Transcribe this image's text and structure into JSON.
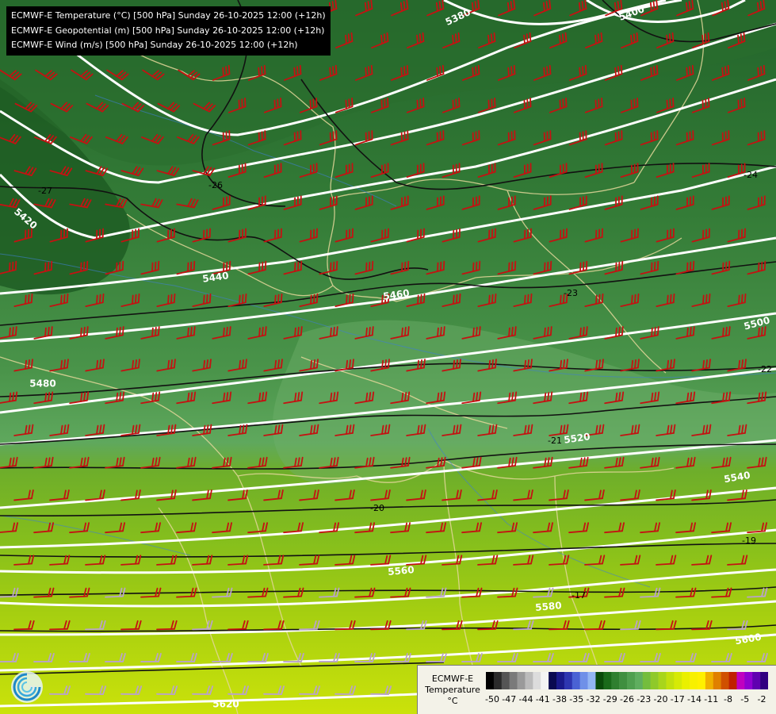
{
  "title_lines": [
    "ECMWF-E Temperature (°C) [500 hPa] Sunday 26-10-2025 12:00 (+12h)",
    "ECMWF-E Geopotential (m) [500 hPa] Sunday 26-10-2025 12:00 (+12h)",
    "ECMWF-E Wind (m/s) [500 hPa] Sunday 26-10-2025 12:00 (+12h)"
  ],
  "legend": {
    "title": [
      "ECMWF-E",
      "Temperature",
      "°C"
    ],
    "tick_labels": [
      "-50",
      "-47",
      "-44",
      "-41",
      "-38",
      "-35",
      "-32",
      "-29",
      "-26",
      "-23",
      "-20",
      "-17",
      "-14",
      "-11",
      "-8",
      "-5",
      "-2"
    ],
    "colors": [
      "#000000",
      "#2a2a2a",
      "#555555",
      "#7a7a7a",
      "#9a9a9a",
      "#bbbbbb",
      "#dcdcdc",
      "#f4f4f4",
      "#0a0a50",
      "#1a1a8a",
      "#2e36b0",
      "#4a62d4",
      "#6f90e8",
      "#93b6f4",
      "#0a4a0a",
      "#1a6a1a",
      "#2f7f2f",
      "#3f8f3f",
      "#4f9f4f",
      "#5fae5f",
      "#74bd3d",
      "#8fc92a",
      "#a8d51c",
      "#c2e00e",
      "#d6ea06",
      "#eaf000",
      "#f8f000",
      "#fff000",
      "#f0b000",
      "#e08000",
      "#d05000",
      "#c02000",
      "#c000c0",
      "#9000d0",
      "#6000b0",
      "#300080"
    ]
  },
  "geopotential_labels": [
    "5380",
    "5400",
    "5420",
    "5440",
    "5460",
    "5480",
    "5500",
    "5520",
    "5540",
    "5560",
    "5580",
    "5600",
    "5620"
  ],
  "isotherm_labels": [
    "-27",
    "-26",
    "-24",
    "-23",
    "-22",
    "-21",
    "-20",
    "-19",
    "-17"
  ],
  "logo_icon": "ecmwf-swirl-logo-icon"
}
